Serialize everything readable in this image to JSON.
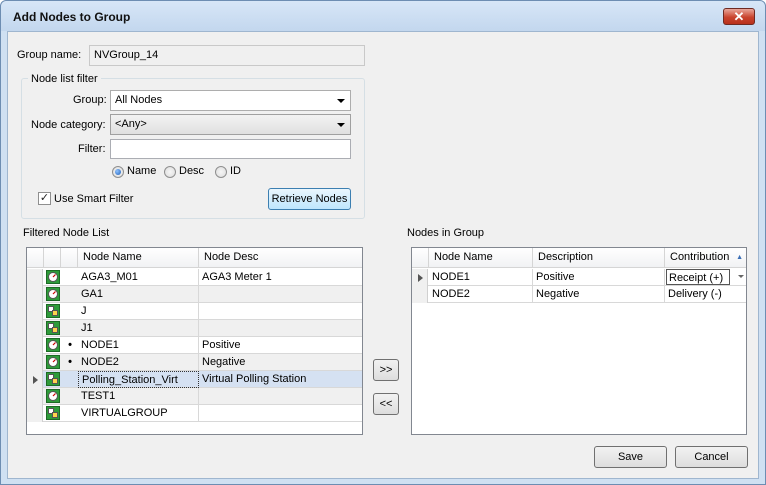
{
  "window": {
    "title": "Add Nodes to Group",
    "close_glyph": "✕"
  },
  "group_name": {
    "label": "Group name:",
    "value": "NVGroup_14"
  },
  "filter": {
    "legend": "Node list filter",
    "group_label": "Group:",
    "group_value": "All Nodes",
    "category_label": "Node category:",
    "category_value": "<Any>",
    "filter_label": "Filter:",
    "filter_value": "",
    "radio_name": "Name",
    "radio_desc": "Desc",
    "radio_id": "ID",
    "selected_radio": "Name",
    "smart_filter_label": "Use Smart Filter",
    "smart_filter_checked": true,
    "check_glyph": "✓",
    "retrieve_button": "Retrieve Nodes"
  },
  "filtered_list": {
    "title": "Filtered Node List",
    "columns": [
      "Node Name",
      "Node Desc"
    ],
    "rows": [
      {
        "icon": "meter-node-icon",
        "mark": "",
        "name": "AGA3_M01",
        "desc": "AGA3 Meter 1"
      },
      {
        "icon": "meter-node-icon",
        "mark": "",
        "name": "GA1",
        "desc": ""
      },
      {
        "icon": "virtual-node-icon",
        "mark": "",
        "name": "J",
        "desc": ""
      },
      {
        "icon": "virtual-node-icon",
        "mark": "",
        "name": "J1",
        "desc": ""
      },
      {
        "icon": "meter-node-icon",
        "mark": "•",
        "name": "NODE1",
        "desc": "Positive"
      },
      {
        "icon": "meter-node-icon",
        "mark": "•",
        "name": "NODE2",
        "desc": "Negative"
      },
      {
        "icon": "virtual-node-icon",
        "mark": "",
        "name": "Polling_Station_Virt",
        "desc": "Virtual Polling Station"
      },
      {
        "icon": "meter-node-icon",
        "mark": "",
        "name": "TEST1",
        "desc": ""
      },
      {
        "icon": "virtual-node-icon",
        "mark": "",
        "name": "VIRTUALGROUP",
        "desc": ""
      }
    ],
    "selected_row": 6
  },
  "add_button": ">>",
  "remove_button": "<<",
  "group_list": {
    "title": "Nodes in Group",
    "columns": [
      "Node Name",
      "Description",
      "Contribution"
    ],
    "sort_glyph": "▲",
    "rows": [
      {
        "name": "NODE1",
        "desc": "Positive",
        "contribution": "Receipt (+)"
      },
      {
        "name": "NODE2",
        "desc": "Negative",
        "contribution": "Delivery (-)"
      }
    ]
  },
  "save_button": "Save",
  "cancel_button": "Cancel",
  "colors": {
    "selection": "#d5e1f2",
    "title_bg": "#cfe0f2",
    "close_red": "#c9442e"
  }
}
